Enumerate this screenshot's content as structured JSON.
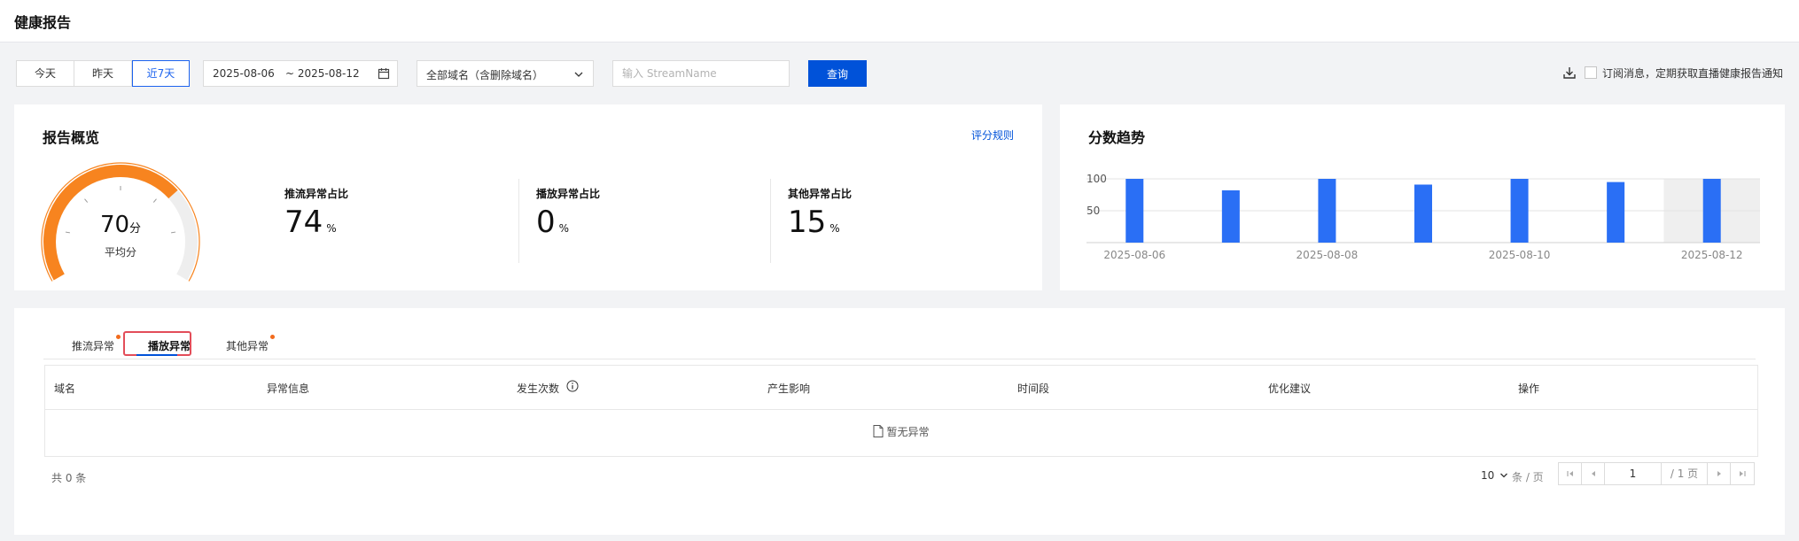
{
  "header": {
    "title": "健康报告"
  },
  "toolbar": {
    "range_options": [
      "今天",
      "昨天",
      "近7天"
    ],
    "active_range": "近7天",
    "date_start": "2025-08-06",
    "date_end": "~ 2025-08-12",
    "domain_select": "全部域名（含删除域名）",
    "search_placeholder": "输入 StreamName",
    "query_label": "查询",
    "subscribe_text": "订阅消息，定期获取直播健康报告通知"
  },
  "overview": {
    "title": "报告概览",
    "rule_link": "评分规则",
    "score": "70",
    "score_unit": "分",
    "score_label": "平均分",
    "score_fraction": 0.7,
    "metrics": [
      {
        "label": "推流异常占比",
        "value": "74",
        "unit": "%"
      },
      {
        "label": "播放异常占比",
        "value": "0",
        "unit": "%"
      },
      {
        "label": "其他异常占比",
        "value": "15",
        "unit": "%"
      }
    ]
  },
  "trend": {
    "title": "分数趋势",
    "chart_data": {
      "type": "bar",
      "categories": [
        "2025-08-06",
        "2025-08-07",
        "2025-08-08",
        "2025-08-09",
        "2025-08-10",
        "2025-08-11",
        "2025-08-12"
      ],
      "tick_labels": [
        "2025-08-06",
        "2025-08-08",
        "2025-08-10",
        "2025-08-12"
      ],
      "values": [
        100,
        82,
        100,
        91,
        100,
        95,
        100
      ],
      "yticks": [
        "100",
        "50"
      ],
      "ylim": [
        0,
        100
      ],
      "grid": true,
      "highlight_category": "2025-08-12",
      "bar_color": "#2a6ff5"
    }
  },
  "table_section": {
    "tabs": [
      {
        "label": "推流异常",
        "dot": true
      },
      {
        "label": "播放异常",
        "dot": false
      },
      {
        "label": "其他异常",
        "dot": true
      }
    ],
    "active_tab": "播放异常",
    "columns": [
      "域名",
      "异常信息",
      "发生次数",
      "产生影响",
      "时间段",
      "优化建议",
      "操作"
    ],
    "empty_text": "暂无异常",
    "total_text": "共 0 条",
    "page_size": "10",
    "per_page_text": "条 / 页",
    "current_page": "1",
    "total_pages": "/ 1 页"
  },
  "colors": {
    "accent": "#0052d9",
    "gauge": "#f7841f",
    "alert": "#e34d59"
  }
}
